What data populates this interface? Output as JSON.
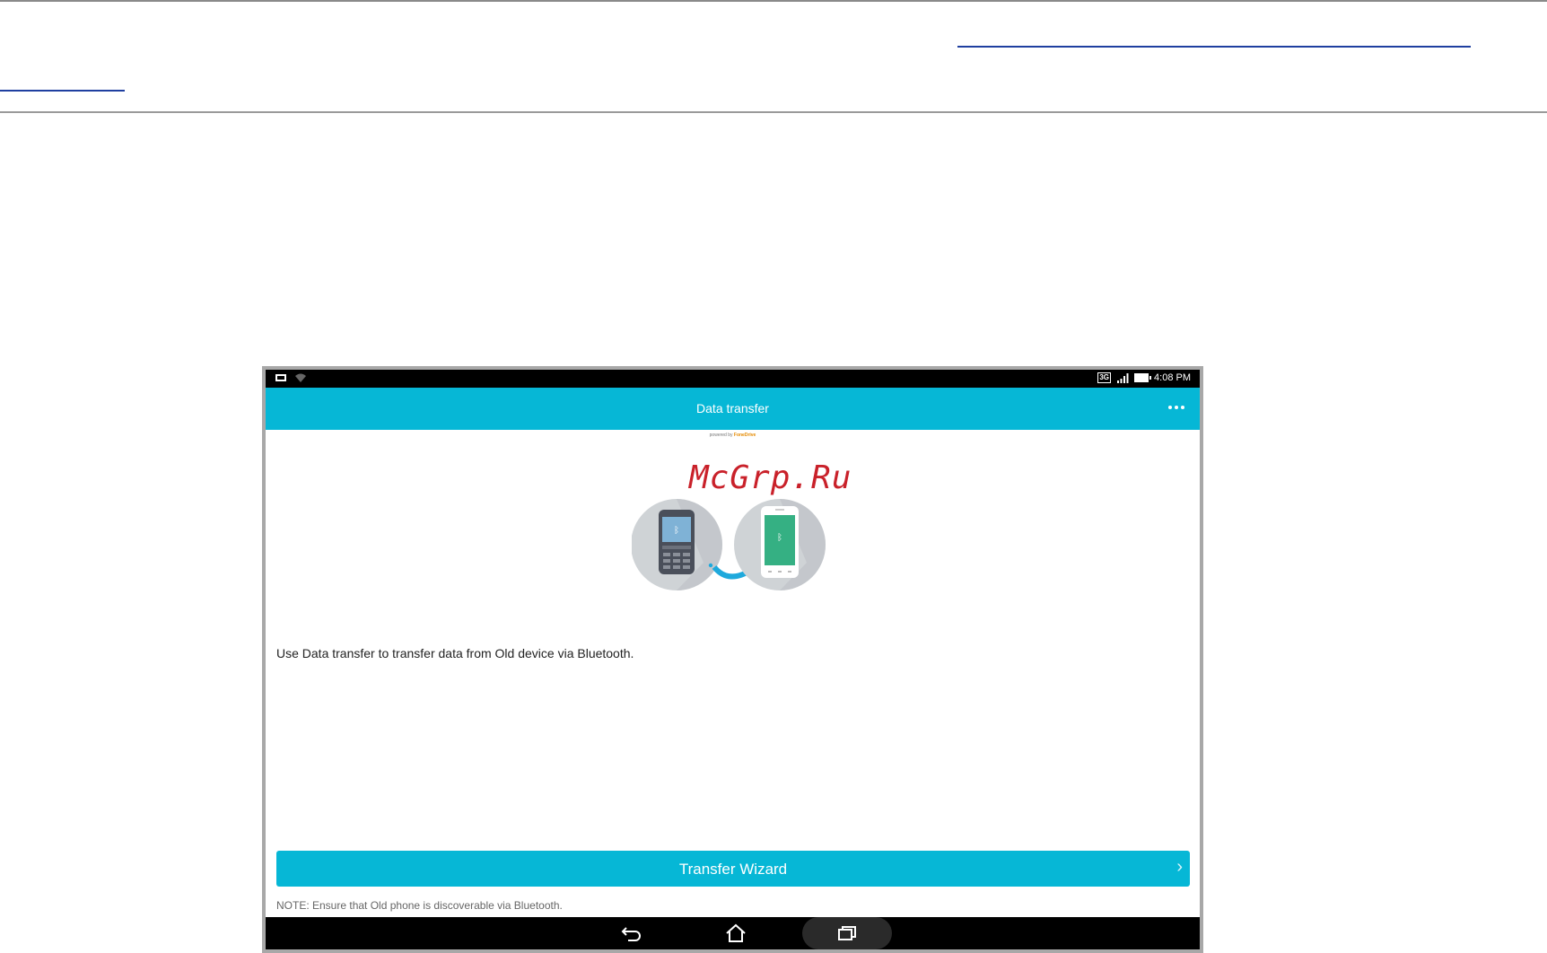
{
  "page": {
    "watermark": "McGrp.Ru"
  },
  "status_bar": {
    "network_badge": "3G",
    "time": "4:08 PM"
  },
  "app": {
    "title": "Data transfer",
    "more_icon": "overflow-menu-icon",
    "powered_by_prefix": "powered by",
    "powered_by_brand": "FoneDrive",
    "intro_text": "Use Data transfer to transfer data from Old device via Bluetooth.",
    "wizard_button_label": "Transfer Wizard",
    "wizard_chevron": "›",
    "note": "NOTE: Ensure that Old phone is discoverable via Bluetooth."
  },
  "nav_bar": {
    "back_icon": "back-icon",
    "home_icon": "home-icon",
    "recent_icon": "recent-apps-icon"
  },
  "colors": {
    "accent": "#06b7d6",
    "watermark": "#c9212a",
    "link": "#1f3fa0"
  }
}
